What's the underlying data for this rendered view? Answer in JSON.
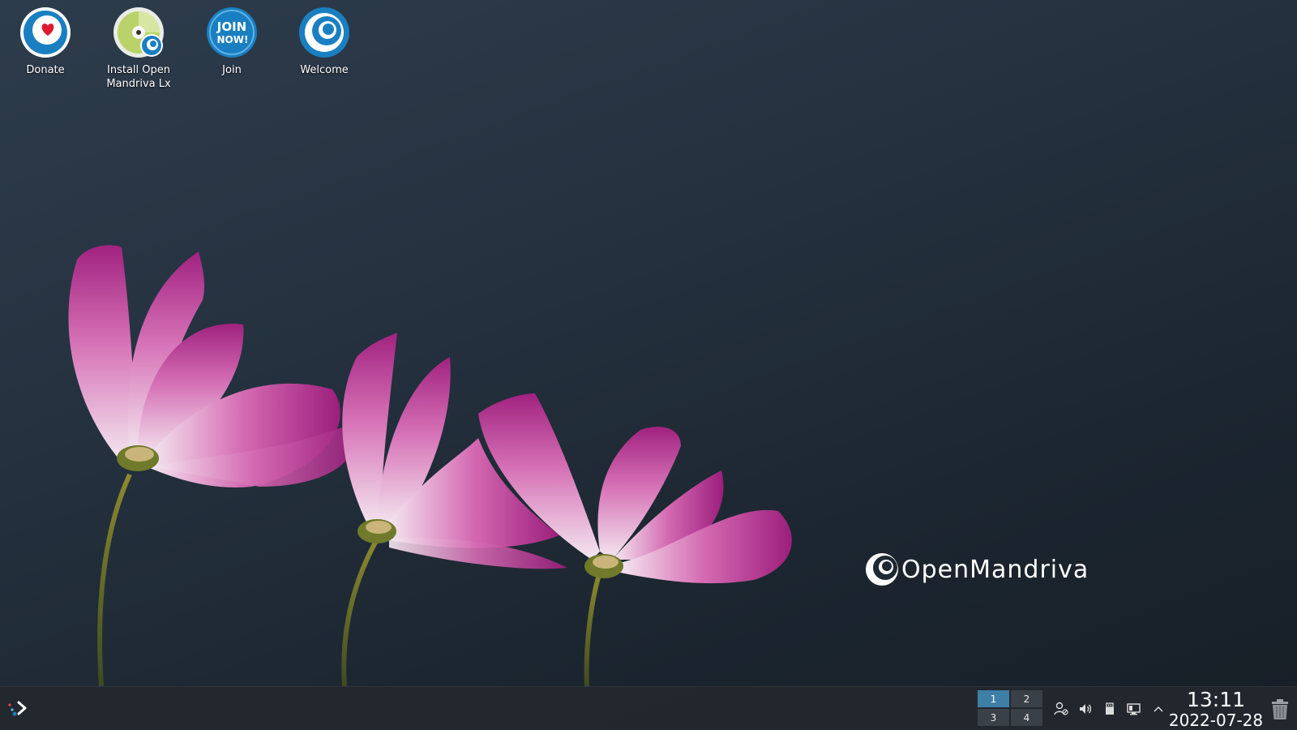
{
  "desktop": {
    "icons": [
      {
        "label": "Donate",
        "icon": "donate-heart-icon"
      },
      {
        "label": "Install Open Mandriva Lx",
        "icon": "install-disc-icon"
      },
      {
        "label": "Join",
        "icon": "join-now-icon"
      },
      {
        "label": "Welcome",
        "icon": "welcome-openmandriva-icon"
      }
    ],
    "join_badge_text": [
      "JOIN",
      "NOW!"
    ],
    "brand_text": "OpenMandriva"
  },
  "taskbar": {
    "launcher_icon": "application-launcher-icon",
    "pager": [
      {
        "label": "1",
        "active": true
      },
      {
        "label": "2",
        "active": false
      },
      {
        "label": "3",
        "active": false
      },
      {
        "label": "4",
        "active": false
      }
    ],
    "tray_icons": [
      "user-network-icon",
      "volume-icon",
      "usb-device-icon",
      "display-icon",
      "chevron-up-icon"
    ],
    "clock": {
      "time": "13:11",
      "date": "2022-07-28"
    },
    "trash_icon": "trash-icon"
  },
  "colors": {
    "accent": "#3d7fa6",
    "om_blue": "#1a7fc1",
    "petal_pink": "#b02a8e"
  }
}
